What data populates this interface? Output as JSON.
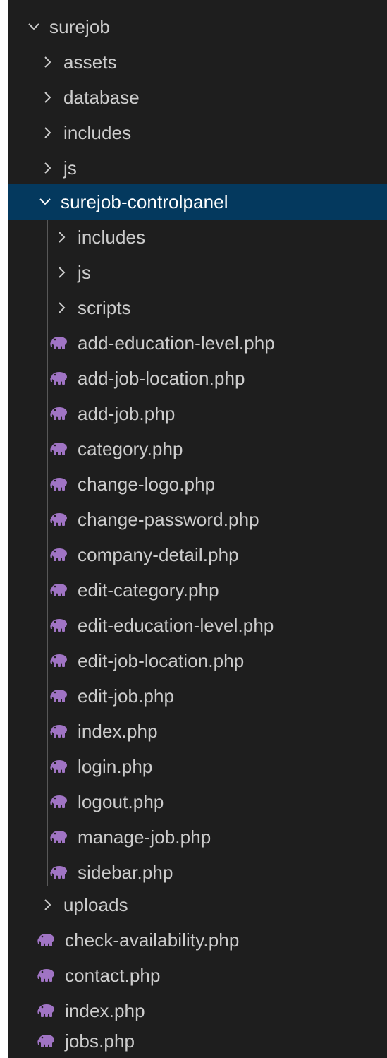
{
  "explorer": {
    "root": {
      "label": "surejob",
      "expanded": true
    },
    "folders_top": [
      {
        "label": "assets",
        "expanded": false
      },
      {
        "label": "database",
        "expanded": false
      },
      {
        "label": "includes",
        "expanded": false
      },
      {
        "label": "js",
        "expanded": false
      }
    ],
    "controlpanel": {
      "label": "surejob-controlpanel",
      "expanded": true,
      "selected": true,
      "folders": [
        {
          "label": "includes",
          "expanded": false
        },
        {
          "label": "js",
          "expanded": false
        },
        {
          "label": "scripts",
          "expanded": false
        }
      ],
      "files": [
        {
          "label": "add-education-level.php",
          "icon": "php-elephant-icon"
        },
        {
          "label": "add-job-location.php",
          "icon": "php-elephant-icon"
        },
        {
          "label": "add-job.php",
          "icon": "php-elephant-icon"
        },
        {
          "label": "category.php",
          "icon": "php-elephant-icon"
        },
        {
          "label": "change-logo.php",
          "icon": "php-elephant-icon"
        },
        {
          "label": "change-password.php",
          "icon": "php-elephant-icon"
        },
        {
          "label": "company-detail.php",
          "icon": "php-elephant-icon"
        },
        {
          "label": "edit-category.php",
          "icon": "php-elephant-icon"
        },
        {
          "label": "edit-education-level.php",
          "icon": "php-elephant-icon"
        },
        {
          "label": "edit-job-location.php",
          "icon": "php-elephant-icon"
        },
        {
          "label": "edit-job.php",
          "icon": "php-elephant-icon"
        },
        {
          "label": "index.php",
          "icon": "php-elephant-icon"
        },
        {
          "label": "login.php",
          "icon": "php-elephant-icon"
        },
        {
          "label": "logout.php",
          "icon": "php-elephant-icon"
        },
        {
          "label": "manage-job.php",
          "icon": "php-elephant-icon"
        },
        {
          "label": "sidebar.php",
          "icon": "php-elephant-icon"
        }
      ]
    },
    "uploads": {
      "label": "uploads",
      "expanded": false
    },
    "root_files": [
      {
        "label": "check-availability.php",
        "icon": "php-elephant-icon"
      },
      {
        "label": "contact.php",
        "icon": "php-elephant-icon"
      },
      {
        "label": "index.php",
        "icon": "php-elephant-icon"
      },
      {
        "label": "jobs.php",
        "icon": "php-elephant-icon"
      }
    ],
    "colors": {
      "background": "#1e1e1e",
      "text": "#cccccc",
      "selected_background": "#04395e",
      "php_icon": "#a074c4",
      "indent_guide": "#585858"
    }
  }
}
